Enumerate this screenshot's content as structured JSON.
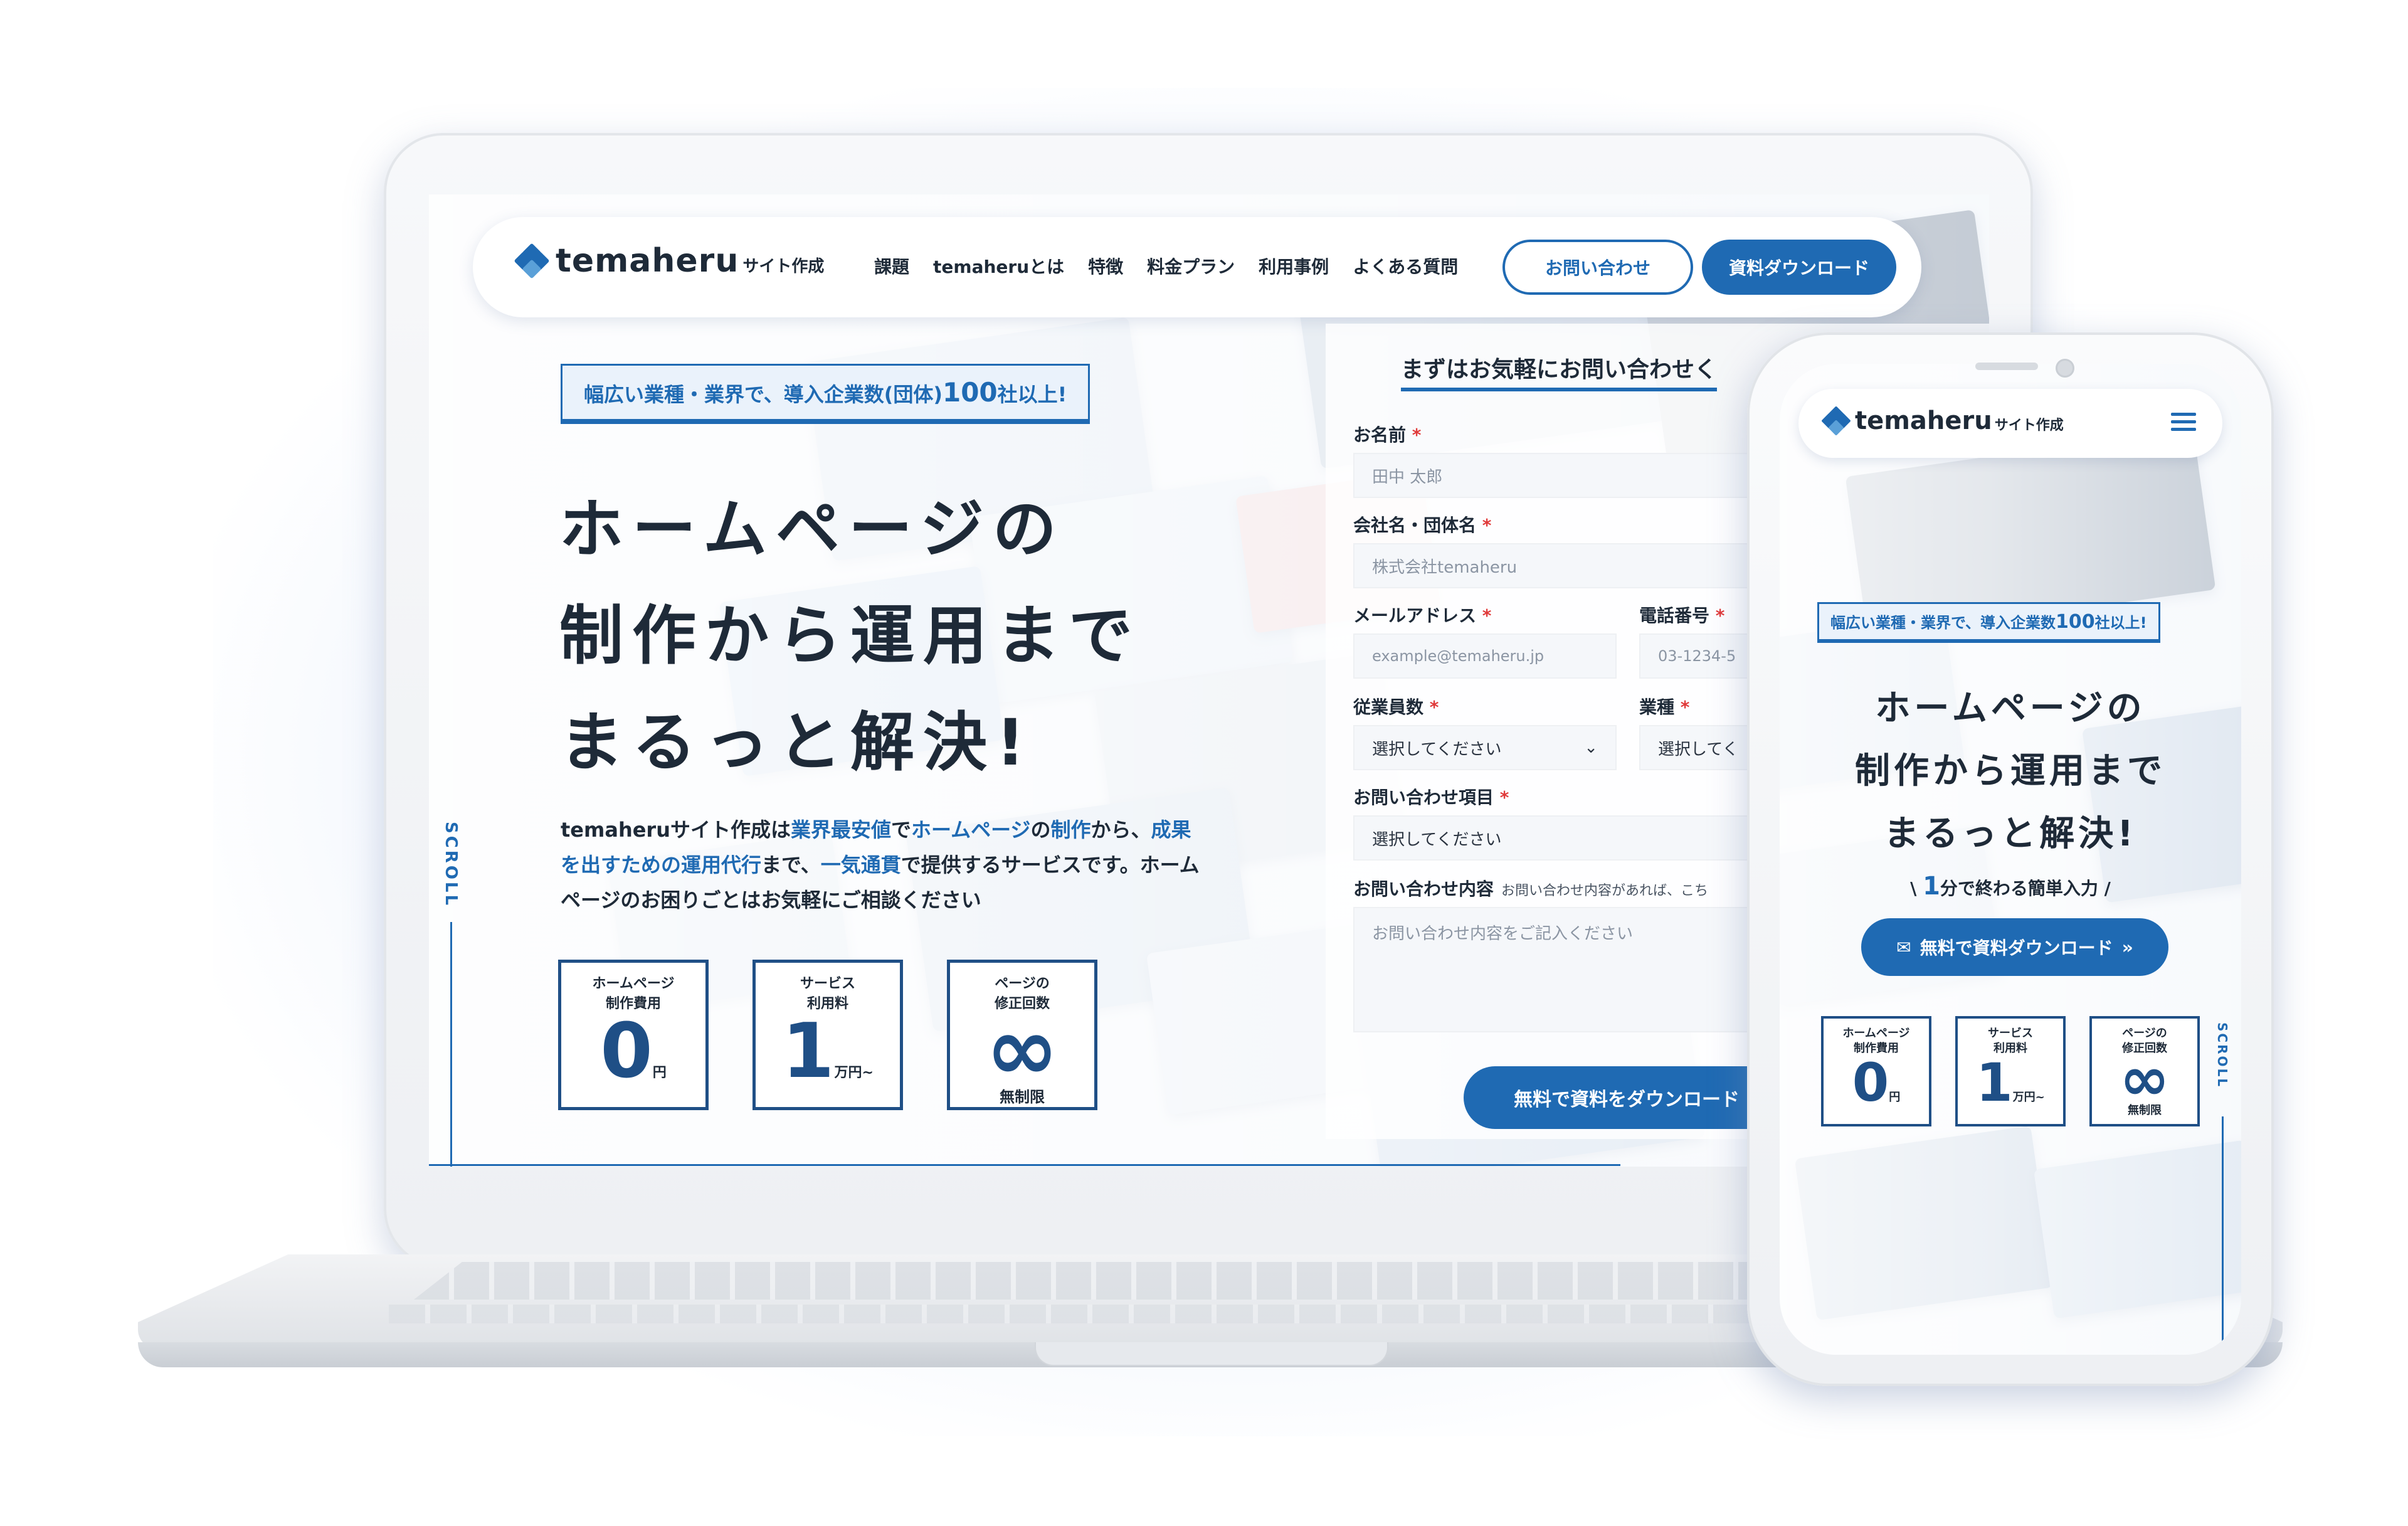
{
  "brand": {
    "name": "temaheru",
    "suffix": "サイト作成"
  },
  "nav": {
    "links": [
      "課題",
      "temaheruとは",
      "特徴",
      "料金プラン",
      "利用事例",
      "よくある質問"
    ],
    "contact_button": "お問い合わせ",
    "download_button": "資料ダウンロード"
  },
  "hero": {
    "badge_pre": "幅広い業種・業界で、導入企業数(団体)",
    "badge_num": "100",
    "badge_post": "社以上!",
    "headline_1": "ホームページの",
    "headline_2": "制作から運用まで",
    "headline_3": "まるっと解決!",
    "lead": [
      {
        "t": "temaheruサイト作成は",
        "hl": false
      },
      {
        "t": "業界最安値",
        "hl": true
      },
      {
        "t": "で",
        "hl": false
      },
      {
        "t": "ホームページ",
        "hl": true
      },
      {
        "t": "の",
        "hl": false
      },
      {
        "t": "制作",
        "hl": true
      },
      {
        "t": "から、",
        "hl": false
      },
      {
        "t": "成果を出すための運用代行",
        "hl": true
      },
      {
        "t": "まで、",
        "hl": false
      },
      {
        "t": "一気通貫",
        "hl": true
      },
      {
        "t": "で提供するサービスです。ホームページのお困りごとはお気軽にご相談ください",
        "hl": false
      }
    ],
    "scroll": "SCROLL",
    "stats": [
      {
        "label_1": "ホームページ",
        "label_2": "制作費用",
        "value": "0",
        "unit": "円"
      },
      {
        "label_1": "サービス",
        "label_2": "利用料",
        "value": "1",
        "unit": "万円~"
      },
      {
        "label_1": "ページの",
        "label_2": "修正回数",
        "value": "∞",
        "unit": "無制限"
      }
    ]
  },
  "form": {
    "title": "まずはお気軽にお問い合わせく",
    "name_label": "お名前",
    "name_placeholder": "田中 太郎",
    "company_label": "会社名・団体名",
    "company_placeholder": "株式会社temaheru",
    "email_label": "メールアドレス",
    "email_placeholder": "example@temaheru.jp",
    "phone_label": "電話番号",
    "phone_placeholder": "03-1234-5",
    "employees_label": "従業員数",
    "employees_value": "選択してください",
    "industry_label": "業種",
    "industry_value": "選択してく",
    "topic_label": "お問い合わせ項目",
    "topic_value": "選択してください",
    "message_label": "お問い合わせ内容",
    "message_note": "お問い合わせ内容があれば、こち",
    "message_placeholder": "お問い合わせ内容をご記入ください",
    "required_mark": "*",
    "submit": "無料で資料をダウンロード"
  },
  "mobile": {
    "badge_pre": "幅広い業種・業界で、導入企業数",
    "badge_num": "100",
    "badge_post": "社以上!",
    "headline_1": "ホームページの",
    "headline_2": "制作から運用まで",
    "headline_3": "まるっと解決!",
    "quick_pre": "\\",
    "quick_num": "1",
    "quick_text": "分で終わる簡単入力",
    "quick_post": "/",
    "cta": "無料で資料ダウンロード",
    "cta_arrow": "»",
    "scroll": "SCROLL"
  },
  "colors": {
    "accent": "#1f6ab3",
    "dark_accent": "#1f4f86",
    "required": "#e03a3a",
    "text": "#1e2a38"
  },
  "icons": [
    "temaheru-logo-icon",
    "chevron-down-icon",
    "mail-icon",
    "hamburger-menu-icon",
    "double-chevron-right-icon"
  ]
}
